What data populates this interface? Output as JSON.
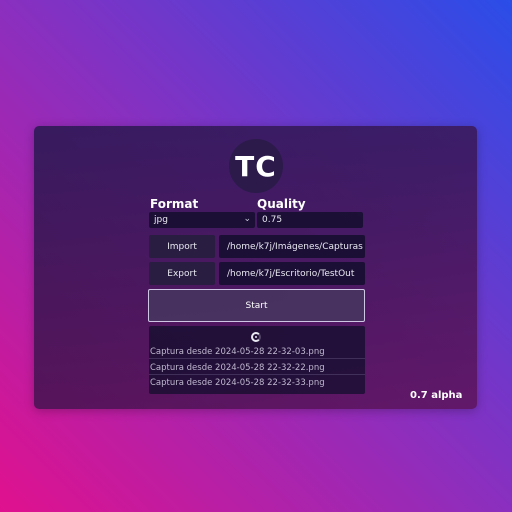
{
  "app": {
    "avatar_text": "TC",
    "version": "0.7 alpha"
  },
  "settings": {
    "format_label": "Format",
    "format_value": "jpg",
    "quality_label": "Quality",
    "quality_value": "0.75"
  },
  "actions": {
    "import_label": "Import",
    "import_path": "/home/k7j/Imágenes/Capturas ...",
    "export_label": "Export",
    "export_path": "/home/k7j/Escritorio/TestOut",
    "start_label": "Start"
  },
  "log": {
    "items": [
      "Captura desde 2024-05-28 22-32-03.png",
      "Captura desde 2024-05-28 22-32-22.png",
      "Captura desde 2024-05-28 22-32-33.png"
    ]
  },
  "icons": {
    "spinner": "loading-spinner-icon",
    "select": "chevron-down-icon"
  },
  "colors": {
    "background_start": "#e0118e",
    "background_end": "#2a4de8",
    "panel": "#2b1a4a"
  }
}
